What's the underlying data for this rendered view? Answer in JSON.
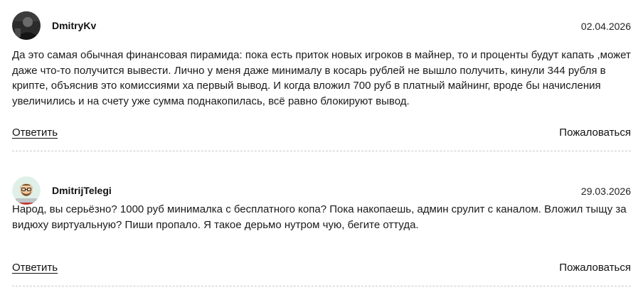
{
  "comments": [
    {
      "author": "DmitryKv",
      "date": "02.04.2026",
      "avatar_icon": "user-photo-avatar",
      "text": "Да это самая обычная финансовая пирамида: пока есть приток новых игроков в майнер, то и проценты будут капать ,может даже что-то получится вывести. Лично у меня даже минималу в косарь рублей не вышло получить, кинули 344 рубля в крипте, объяснив это комиссиями ха первый вывод. И когда вложил 700 руб в платный майнинг, вроде бы начисления увеличились и на счету уже сумма поднакопилась, всё равно блокируют вывод.",
      "reply_label": "Ответить",
      "report_label": "Пожаловаться"
    },
    {
      "author": "DmitrijTelegi",
      "date": "29.03.2026",
      "avatar_icon": "cartoon-character-avatar",
      "text": "Народ, вы серьёзно? 1000 руб минималка с бесплатного копа? Пока накопаешь, админ срулит с каналом. Вложил тыщу за видюху виртуальную? Пиши пропало. Я такое дерьмо нутром чую, бегите оттуда.",
      "reply_label": "Ответить",
      "report_label": "Пожаловаться"
    }
  ]
}
